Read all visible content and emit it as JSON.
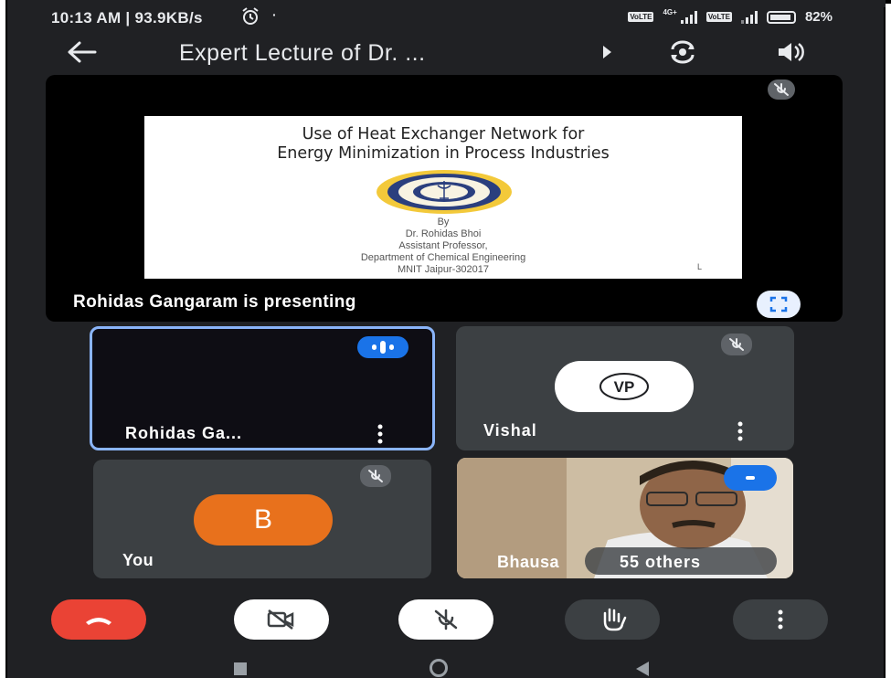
{
  "status_bar": {
    "time_speed": "10:13 AM | 93.9KB/s",
    "network_label": "4G+",
    "volte_label": "VoLTE",
    "battery": "82%"
  },
  "app_bar": {
    "title": "Expert Lecture of Dr. ..."
  },
  "presentation": {
    "slide_title_line1": "Use of Heat Exchanger Network for",
    "slide_title_line2": "Energy Minimization in Process Industries",
    "slide_by": "By",
    "slide_name": "Dr. Rohidas Bhoi",
    "slide_role": "Assistant Professor,",
    "slide_dept": "Department of Chemical Engineering",
    "slide_inst": "MNIT Jaipur-302017",
    "slide_mark": "L",
    "presenting_text": "Rohidas Gangaram  is presenting"
  },
  "participants": [
    {
      "name": "Rohidas Ga...",
      "speaking": true
    },
    {
      "name": "Vishal",
      "initials": "VP"
    },
    {
      "name": "You",
      "initial": "B"
    },
    {
      "name": "Bhausa",
      "others": "55 others"
    }
  ],
  "controls": [
    "end-call",
    "camera-off",
    "mic-off",
    "raise-hand",
    "more-options"
  ],
  "colors": {
    "background": "#202124",
    "tile": "#3c4043",
    "end_call": "#ea4335",
    "avatar_orange": "#e8711c",
    "active_border": "#8ab4f8",
    "speaking_badge": "#1a73e8"
  }
}
